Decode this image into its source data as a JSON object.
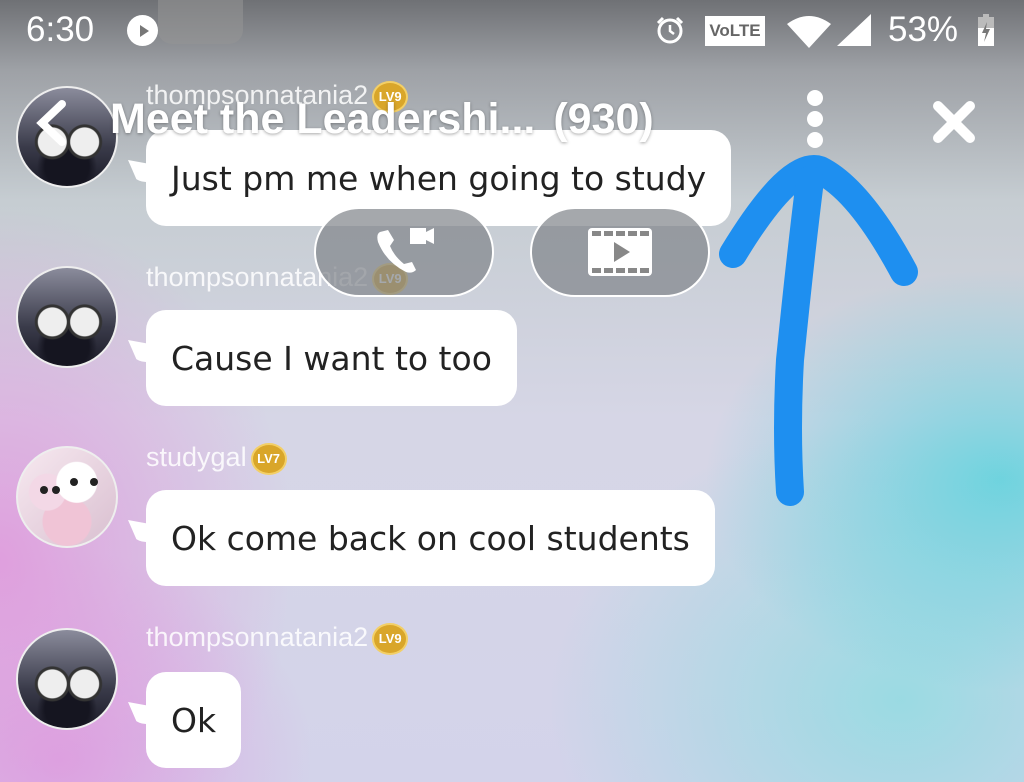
{
  "status_bar": {
    "time": "6:30",
    "media_icon": "play-circle-icon",
    "alarm_icon": "alarm-icon",
    "volte_label": "VoLTE",
    "wifi_icon": "wifi-icon",
    "signal_icon": "cell-signal-icon",
    "battery_percent": "53%",
    "battery_icon": "battery-charging-icon"
  },
  "header": {
    "back_icon": "back-chevron-icon",
    "title": "Meet the Leadershi...",
    "member_count": "(930)",
    "menu_icon": "more-vertical-icon",
    "close_icon": "close-icon"
  },
  "call_buttons": [
    {
      "name": "voice-video-call",
      "icon": "phone-video-icon"
    },
    {
      "name": "screening-room",
      "icon": "film-play-icon"
    }
  ],
  "previous_message_text": "Ok",
  "messages": [
    {
      "user": "thompsonnatania2",
      "level": "LV9",
      "text": "Just pm me when going to study"
    },
    {
      "user": "thompsonnatania2",
      "level": "LV9",
      "text": "Cause I want to too"
    },
    {
      "user": "studygal",
      "level": "LV7",
      "text": "Ok come back on cool students"
    },
    {
      "user": "thompsonnatania2",
      "level": "LV9",
      "text": "Ok"
    }
  ],
  "annotation": {
    "type": "hand-drawn-arrow",
    "color": "#1e8ff0",
    "points_to": "more-vertical-icon"
  }
}
